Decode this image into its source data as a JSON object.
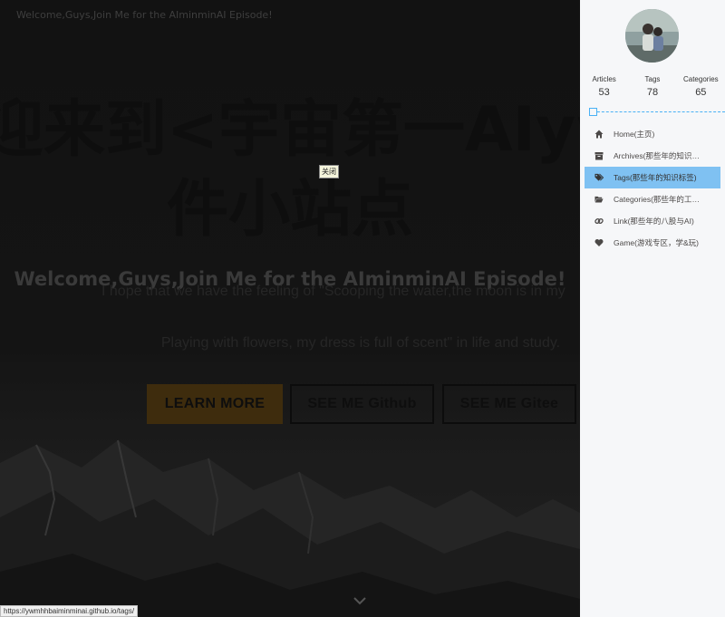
{
  "hero": {
    "top_title": "Welcome,Guys,Join Me for the AIminminAI Episode!",
    "title_line1": "迎来到<宇宙第一AIywm",
    "title_line2": "件小站点",
    "close_tooltip": "关闭",
    "subtitle": "Welcome,Guys,Join Me for the AIminminAI Episode!",
    "quote_line1": "I hope that we have the feeling of \"Scooping the water,the moon is in my",
    "quote_line2": "Playing with flowers, my dress is full of scent\" in life and study.",
    "buttons": {
      "learn_more": "LEARN MORE",
      "github": "SEE ME Github",
      "gitee": "SEE ME Gitee"
    },
    "scroll_icon": "chevron-down-icon"
  },
  "status_bar": {
    "url": "https://ywmhhbaiminminai.github.io/tags/"
  },
  "sidebar": {
    "stats": [
      {
        "label": "Articles",
        "value": "53"
      },
      {
        "label": "Tags",
        "value": "78"
      },
      {
        "label": "Categories",
        "value": "65"
      }
    ],
    "menu": [
      {
        "label": "Home(主页)",
        "icon": "home-icon"
      },
      {
        "label": "Archives(那些年的知识归档)",
        "icon": "archive-icon"
      },
      {
        "label": "Tags(那些年的知识标签)",
        "icon": "tags-icon"
      },
      {
        "label": "Categories(那些年的工作分类)",
        "icon": "folder-open-icon"
      },
      {
        "label": "Link(那些年的八股与AI)",
        "icon": "link-icon"
      },
      {
        "label": "Game(游戏专区，学&玩)",
        "icon": "heart-icon"
      }
    ],
    "active_index": 2,
    "accent_color": "#49b1f5"
  }
}
